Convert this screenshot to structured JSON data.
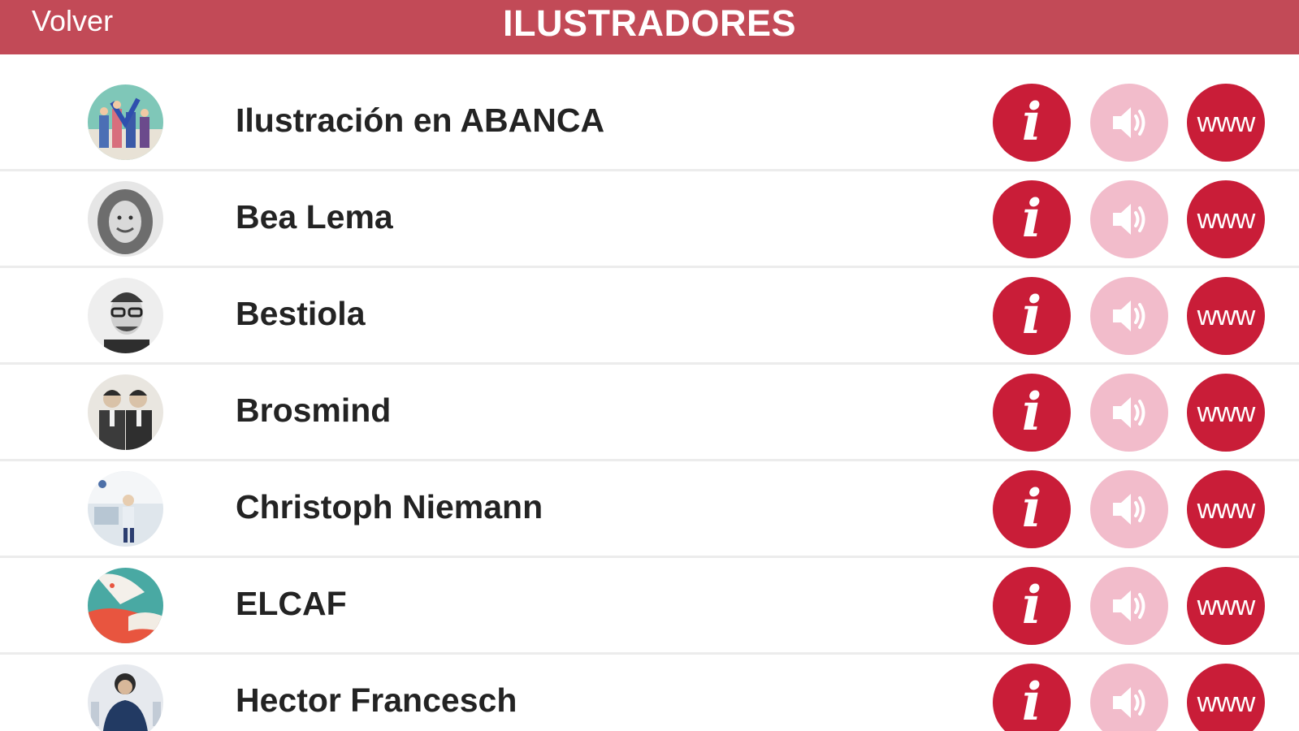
{
  "navbar": {
    "back_label": "Volver",
    "title": "ILUSTRADORES",
    "color": "#c24a57"
  },
  "icons": {
    "info_symbol": "i",
    "web_symbol": "www",
    "audio_icon": "speaker-icon"
  },
  "colors": {
    "accent": "#c91d38",
    "audio_disabled": "#f2bccb"
  },
  "items": [
    {
      "name": "Ilustración en ABANCA"
    },
    {
      "name": "Bea Lema"
    },
    {
      "name": "Bestiola"
    },
    {
      "name": "Brosmind"
    },
    {
      "name": "Christoph Niemann"
    },
    {
      "name": "ELCAF"
    },
    {
      "name": "Hector Francesch"
    }
  ]
}
